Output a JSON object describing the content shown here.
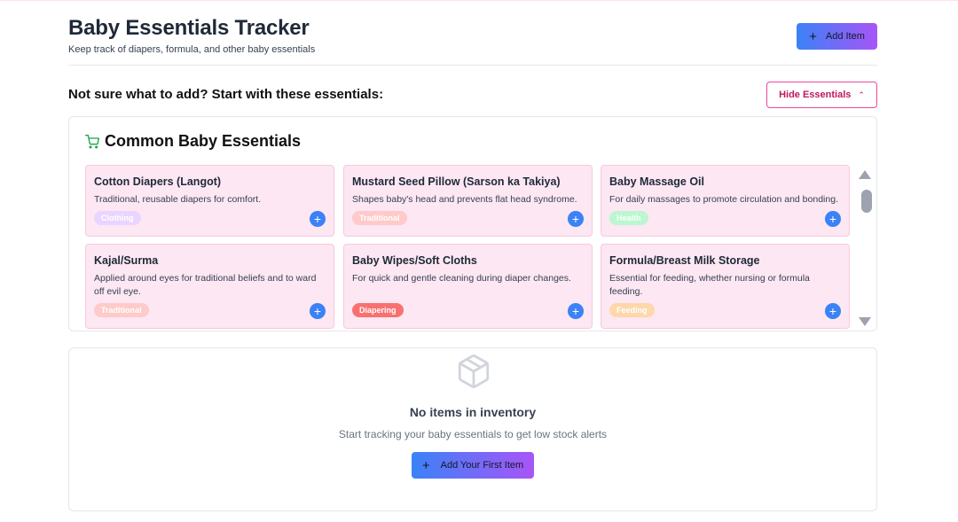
{
  "header": {
    "title": "Baby Essentials Tracker",
    "subtitle": "Keep track of diapers, formula, and other baby essentials",
    "add_button_label": "Add Item",
    "add_button_icon": "plus-icon"
  },
  "suggestions": {
    "heading": "Not sure what to add? Start with these essentials:",
    "toggle_label": "Hide Essentials",
    "toggle_icon": "chevron-up-icon"
  },
  "essentials_panel": {
    "title": "Common Baby Essentials",
    "title_icon": "shopping-cart-icon",
    "items": [
      {
        "name": "Cotton Diapers (Langot)",
        "description": "Traditional, reusable diapers for comfort.",
        "category": "Clothing",
        "category_color": "#e9d5ff"
      },
      {
        "name": "Mustard Seed Pillow (Sarson ka Takiya)",
        "description": "Shapes baby's head and prevents flat head syndrome.",
        "category": "Traditional",
        "category_color": "#fecaca"
      },
      {
        "name": "Baby Massage Oil",
        "description": "For daily massages to promote circulation and bonding.",
        "category": "Health",
        "category_color": "#bbf7d0"
      },
      {
        "name": "Kajal/Surma",
        "description": "Applied around eyes for traditional beliefs and to ward off evil eye.",
        "category": "Traditional",
        "category_color": "#fecaca"
      },
      {
        "name": "Baby Wipes/Soft Cloths",
        "description": "For quick and gentle cleaning during diaper changes.",
        "category": "Diapering",
        "category_color": "#f87171"
      },
      {
        "name": "Formula/Breast Milk Storage",
        "description": "Essential for feeding, whether nursing or formula feeding.",
        "category": "Feeding",
        "category_color": "#fed7aa"
      }
    ]
  },
  "inventory": {
    "empty_icon": "package-icon",
    "empty_title": "No items in inventory",
    "empty_description": "Start tracking your baby essentials to get low stock alerts",
    "first_item_button_label": "Add Your First Item"
  },
  "colors": {
    "accent_gradient_start": "#3b82f6",
    "accent_gradient_end": "#a855f7",
    "card_background": "#fce7f3",
    "toggle_border": "#ec4899",
    "cart_icon": "#16a34a"
  }
}
